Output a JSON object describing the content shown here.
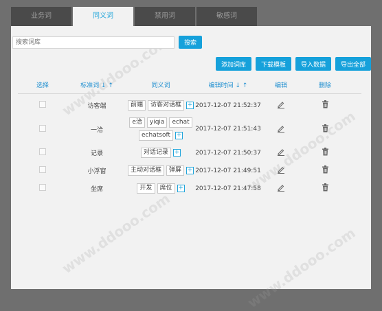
{
  "tabs": [
    {
      "label": "业务词",
      "active": false
    },
    {
      "label": "同义词",
      "active": true
    },
    {
      "label": "禁用词",
      "active": false
    },
    {
      "label": "敏感词",
      "active": false
    }
  ],
  "search": {
    "placeholder": "搜索词库",
    "value": "",
    "button": "搜索"
  },
  "actions": {
    "add": "添加词库",
    "download": "下载模板",
    "import": "导入数据",
    "export": "导出全部"
  },
  "table": {
    "headers": {
      "select": "选择",
      "standard": "标准词 ↓ ↑",
      "synonyms": "同义词",
      "edit_time": "编辑时间 ↓ ↑",
      "edit": "编辑",
      "delete": "删除"
    },
    "rows": [
      {
        "standard": "访客端",
        "synonyms": [
          "前端",
          "访客对话框"
        ],
        "time": "2017-12-07 21:52:37"
      },
      {
        "standard": "一洽",
        "synonyms": [
          "e洽",
          "yiqia",
          "echat",
          "echatsoft"
        ],
        "time": "2017-12-07 21:51:43"
      },
      {
        "standard": "记录",
        "synonyms": [
          "对话记录"
        ],
        "time": "2017-12-07 21:50:37"
      },
      {
        "standard": "小浮窗",
        "synonyms": [
          "主动对话框",
          "弹屏"
        ],
        "time": "2017-12-07 21:49:51"
      },
      {
        "standard": "坐席",
        "synonyms": [
          "开发",
          "席位"
        ],
        "time": "2017-12-07 21:47:58"
      }
    ]
  },
  "icons": {
    "add_synonym": "plus-box-icon",
    "edit": "pencil-icon",
    "delete": "trash-icon"
  },
  "colors": {
    "accent": "#16a1db",
    "tab_bg": "#4a4a4a",
    "panel_bg": "#f2f2f2",
    "outer_bg": "#6f6f6f"
  }
}
